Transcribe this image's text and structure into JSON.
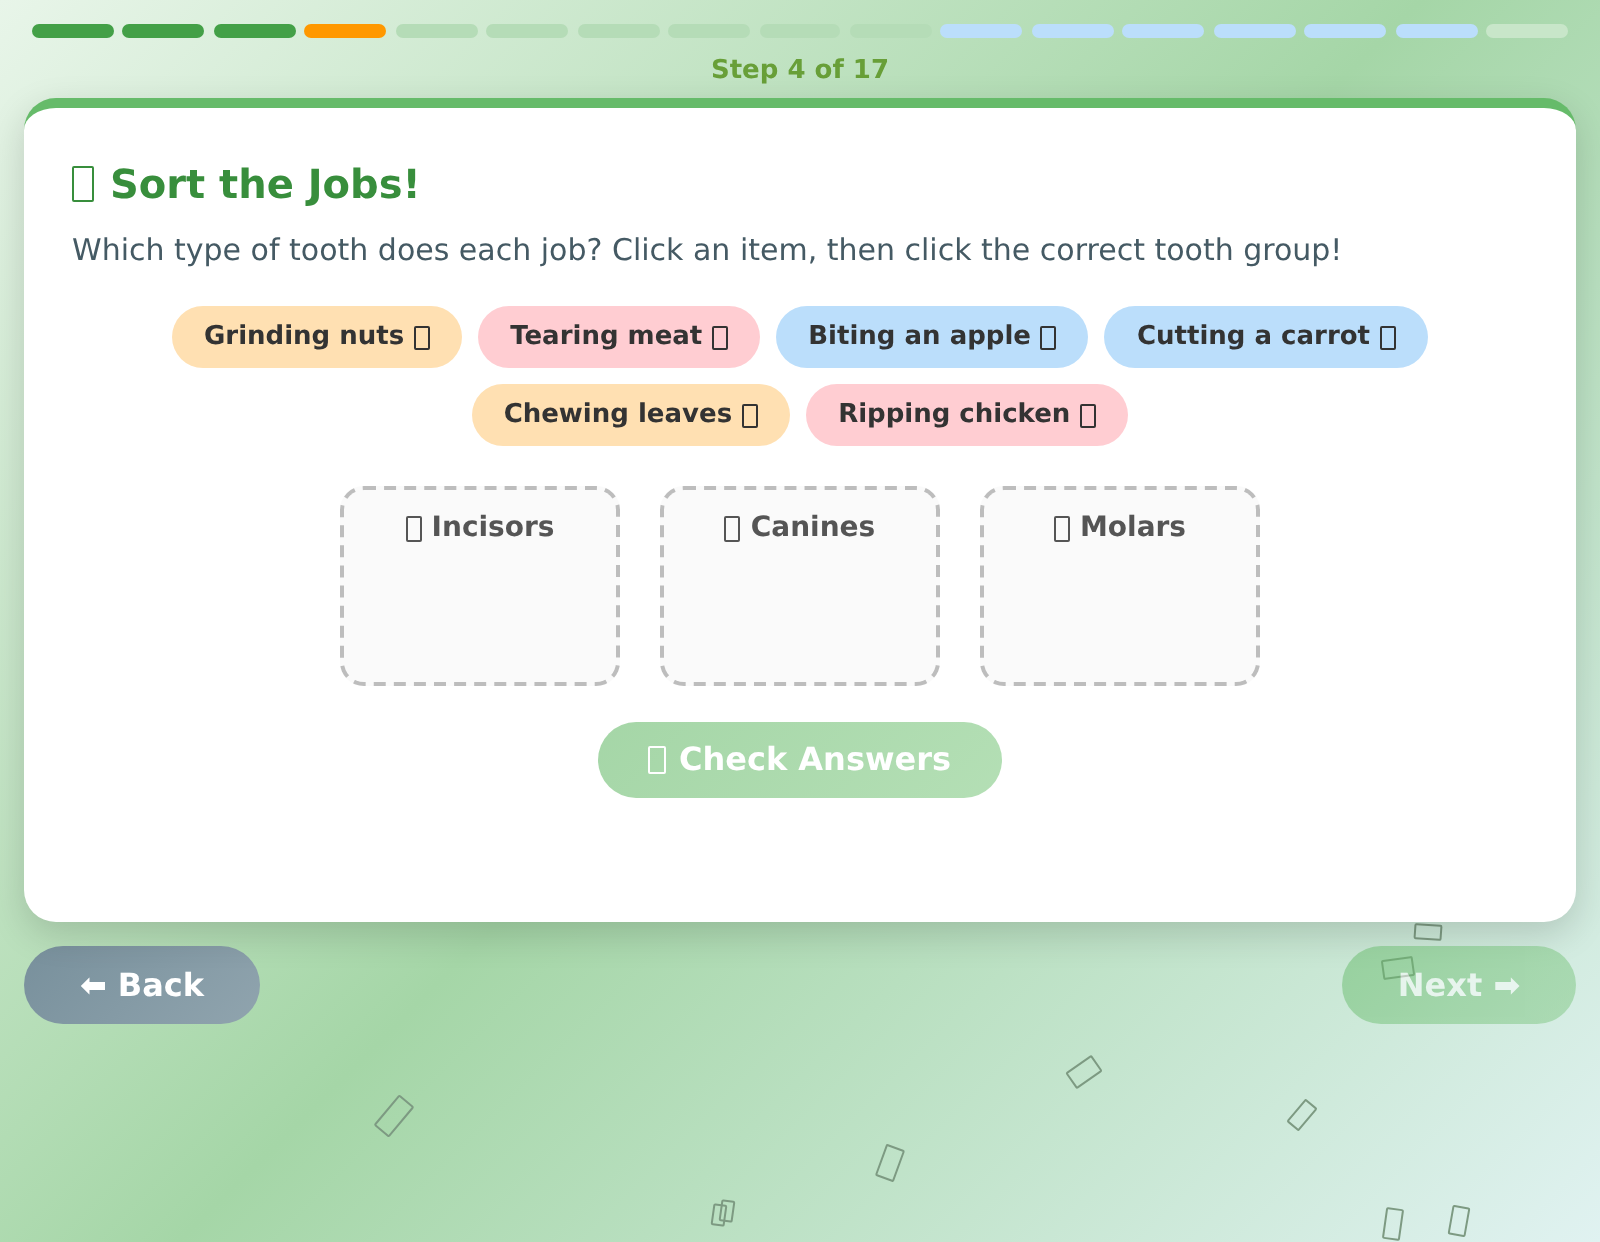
{
  "progress": {
    "steps": [
      {
        "color": "#43a047"
      },
      {
        "color": "#43a047"
      },
      {
        "color": "#43a047"
      },
      {
        "color": "#ff9800"
      },
      {
        "color": "#b5dcb7"
      },
      {
        "color": "#b5dcb7"
      },
      {
        "color": "#b5dcb7"
      },
      {
        "color": "#b5dcb7"
      },
      {
        "color": "#b5dcb7"
      },
      {
        "color": "#b5dcb7"
      },
      {
        "color": "#bbdefb"
      },
      {
        "color": "#bbdefb"
      },
      {
        "color": "#bbdefb"
      },
      {
        "color": "#bbdefb"
      },
      {
        "color": "#bbdefb"
      },
      {
        "color": "#bbdefb"
      },
      {
        "color": "#c8e6c9"
      }
    ],
    "label": "Step 4 of 17"
  },
  "activity": {
    "title": "Sort the Jobs!",
    "instructions": "Which type of tooth does each job? Click an item, then click the correct tooth group!",
    "items": [
      {
        "label": "Grinding nuts",
        "color": "#ffe0b2"
      },
      {
        "label": "Tearing meat",
        "color": "#ffcdd2"
      },
      {
        "label": "Biting an apple",
        "color": "#bbdefb"
      },
      {
        "label": "Cutting a carrot",
        "color": "#bbdefb"
      },
      {
        "label": "Chewing leaves",
        "color": "#ffe0b2"
      },
      {
        "label": "Ripping chicken",
        "color": "#ffcdd2"
      }
    ],
    "groups": [
      {
        "label": "Incisors"
      },
      {
        "label": "Canines"
      },
      {
        "label": "Molars"
      }
    ],
    "check_button": {
      "label": "Check Answers",
      "disabled": true
    }
  },
  "nav": {
    "back": {
      "label": "⬅ Back",
      "disabled": false
    },
    "next": {
      "label": "Next ➡",
      "disabled": true
    }
  }
}
